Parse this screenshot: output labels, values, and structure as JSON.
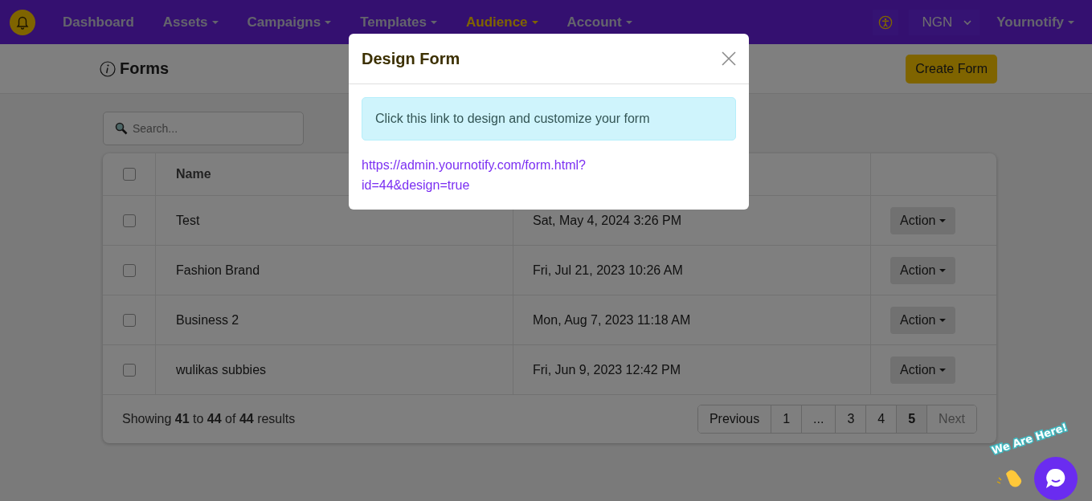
{
  "nav": {
    "items": [
      {
        "label": "Dashboard",
        "dropdown": false,
        "selected": false
      },
      {
        "label": "Assets",
        "dropdown": true,
        "selected": false
      },
      {
        "label": "Campaigns",
        "dropdown": true,
        "selected": false
      },
      {
        "label": "Templates",
        "dropdown": true,
        "selected": false
      },
      {
        "label": "Audience",
        "dropdown": true,
        "selected": true
      },
      {
        "label": "Account",
        "dropdown": true,
        "selected": false
      }
    ],
    "currency": "NGN",
    "account": "Yournotify"
  },
  "page": {
    "title": "Forms",
    "create_button": "Create Form"
  },
  "search": {
    "placeholder": "Search..."
  },
  "table": {
    "header_checked": false,
    "columns": [
      "Name"
    ],
    "rows": [
      {
        "checked": false,
        "name": "Test",
        "date": "Sat, May 4, 2024 3:26 PM",
        "action": "Action"
      },
      {
        "checked": false,
        "name": "Fashion Brand",
        "date": "Fri, Jul 21, 2023 10:26 AM",
        "action": "Action"
      },
      {
        "checked": false,
        "name": "Business 2",
        "date": "Mon, Aug 7, 2023 11:18 AM",
        "action": "Action"
      },
      {
        "checked": false,
        "name": "wulikas subbies",
        "date": "Fri, Jun 9, 2023 12:42 PM",
        "action": "Action"
      }
    ],
    "summary": "Showing **41** to **44** of **44** results",
    "pagination": [
      {
        "label": "Previous",
        "selected": false,
        "disabled": false
      },
      {
        "label": "1",
        "selected": false,
        "disabled": false
      },
      {
        "label": "...",
        "selected": false,
        "disabled": false
      },
      {
        "label": "3",
        "selected": false,
        "disabled": false
      },
      {
        "label": "4",
        "selected": false,
        "disabled": false
      },
      {
        "label": "5",
        "selected": true,
        "disabled": false
      },
      {
        "label": "Next",
        "selected": false,
        "disabled": true
      }
    ]
  },
  "modal": {
    "title": "Design Form",
    "alert": "Click this link to design and customize your form",
    "link": "https://admin.yournotify.com/form.html?id=44&design=true"
  },
  "chat": {
    "label": "We Are Here!"
  }
}
